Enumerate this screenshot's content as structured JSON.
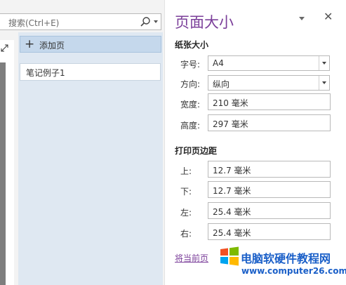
{
  "search": {
    "placeholder": "搜索(Ctrl+E)"
  },
  "pages": {
    "add_label": "添加页",
    "items": [
      {
        "label": "笔记例子1"
      }
    ]
  },
  "pane": {
    "title": "页面大小",
    "paper_section": "纸张大小",
    "size_label": "字号:",
    "size_value": "A4",
    "orientation_label": "方向:",
    "orientation_value": "纵向",
    "width_label": "宽度:",
    "width_value": "210 毫米",
    "height_label": "高度:",
    "height_value": "297 毫米",
    "margins_section": "打印页边距",
    "margin_top_label": "上:",
    "margin_top_value": "12.7 毫米",
    "margin_bottom_label": "下:",
    "margin_bottom_value": "12.7 毫米",
    "margin_left_label": "左:",
    "margin_left_value": "25.4 毫米",
    "margin_right_label": "右:",
    "margin_right_value": "25.4 毫米",
    "link_text": "将当前页"
  },
  "watermark": {
    "title": "电脑软硬件教程网",
    "url": "www.computer26.com"
  },
  "colors": {
    "accent": "#7b3f9a",
    "page_panel": "#dfe8f2",
    "selected_tab": "#c5d8ec",
    "watermark_blue": "#1a5fc8"
  },
  "icons": {
    "search": "search-icon",
    "expand": "expand-icon",
    "add": "plus-icon",
    "close": "close-icon",
    "menu": "dropdown-icon",
    "logo": "windows-logo-icon"
  }
}
